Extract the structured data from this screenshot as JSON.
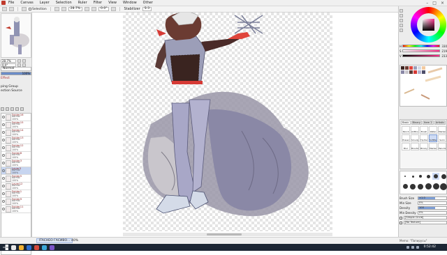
{
  "menu": {
    "items": [
      "File",
      "Canvas",
      "Layer",
      "Selection",
      "Ruler",
      "Filter",
      "View",
      "Window",
      "Other"
    ]
  },
  "toolbar": {
    "selection_label": "Selection",
    "zoom_value": "28.7%",
    "rotation_value": "0.0°",
    "stabilizer_label": "Stabilizer",
    "stabilizer_value": "S-3"
  },
  "navigator": {
    "zoom_value": "28.7%",
    "rotation_value": "0.0°"
  },
  "layer_panel": {
    "effect_label": "Effect",
    "blend_mode": "Normal",
    "opacity": "100%",
    "clipping_group_label": "ping Group",
    "selection_source_label": "ection Source",
    "layers": [
      {
        "name": "Folder16",
        "mode": "Normal",
        "opacity": "100%",
        "selected": false
      },
      {
        "name": "Folder15",
        "mode": "Normal",
        "opacity": "100%",
        "selected": false
      },
      {
        "name": "Folder14",
        "mode": "Normal",
        "opacity": "100%",
        "selected": false
      },
      {
        "name": "Folder13",
        "mode": "Normal",
        "opacity": "100%",
        "selected": false
      },
      {
        "name": "Folder12",
        "mode": "Normal",
        "opacity": "100%",
        "selected": false
      },
      {
        "name": "Folder8",
        "mode": "Normal",
        "opacity": "100%",
        "selected": false
      },
      {
        "name": "Folder3",
        "mode": "Normal",
        "opacity": "100%",
        "selected": false
      },
      {
        "name": "Layer3",
        "mode": "Normal",
        "opacity": "100%",
        "selected": true
      },
      {
        "name": "Folder5",
        "mode": "Normal",
        "opacity": "100%",
        "selected": false
      },
      {
        "name": "Layer12",
        "mode": "Normal",
        "opacity": "100%",
        "selected": false
      },
      {
        "name": "Folder1",
        "mode": "Normal",
        "opacity": "100%",
        "selected": false
      },
      {
        "name": "Folder9",
        "mode": "Normal",
        "opacity": "100%",
        "selected": false
      },
      {
        "name": "Folder11",
        "mode": "Normal",
        "opacity": "100%",
        "selected": false
      }
    ]
  },
  "canvas": {
    "tab_label": "Stabilizer S-3"
  },
  "color_panel": {
    "slider_labels": [
      "H",
      "S",
      "V"
    ],
    "slider_values": [
      "330",
      "219",
      "233"
    ],
    "accent_color": "#ff2d8a"
  },
  "tool_panel": {
    "tabs": [
      "Basic",
      "Binary",
      "Item 2",
      "Artistic"
    ],
    "tools": [
      "Pencil",
      "AirBrush",
      "Brush",
      "Water",
      "Marker",
      "Eraser",
      "Smudge",
      "Tip Pen",
      "SoftPen",
      "Sumi",
      "Blur",
      "Brush2",
      "Binary",
      "Markers",
      "Pencil2"
    ],
    "selected_tool": "SoftPen"
  },
  "brush_props": {
    "size_label": "Brush Size",
    "size_value": "×1.0",
    "min_size_label": "Min Size",
    "min_size_value": "0%",
    "density_label": "Density",
    "density_value": "100",
    "min_density_label": "Min Density",
    "min_density_value": "0%",
    "shape_label": "[Simple Circle]",
    "texture_label": "[No Texture]"
  },
  "status": {
    "doc_tab": "ITACHEO ГАСИВО...",
    "zoom": "40%",
    "memo": "Memo: \"Папирусы\""
  },
  "taskbar": {
    "clock": "0:52:42"
  }
}
